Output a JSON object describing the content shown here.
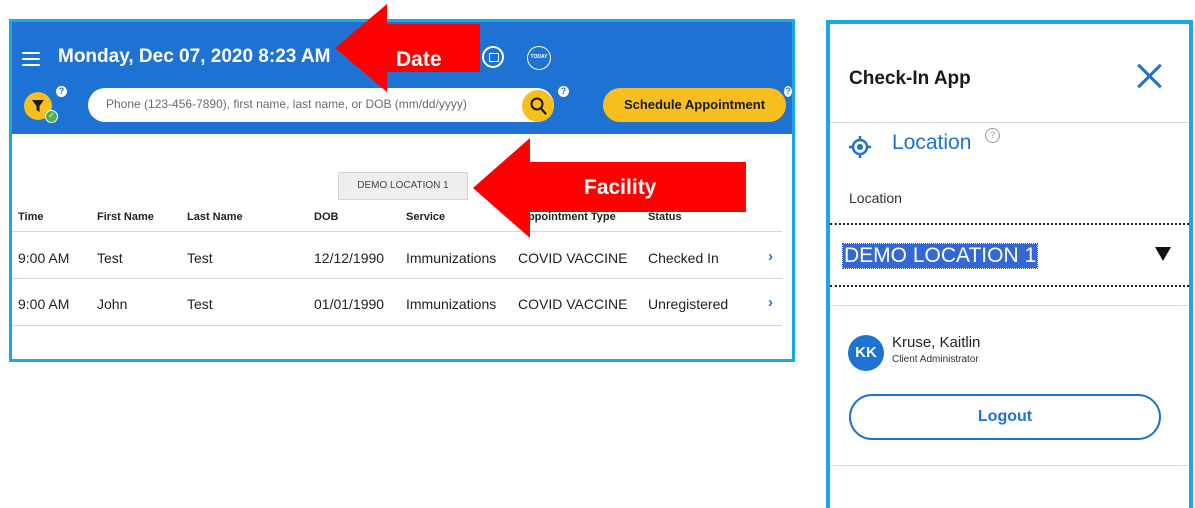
{
  "header": {
    "datetime": "Monday, Dec 07, 2020 8:23 AM",
    "today_label": "TODAY",
    "help_mark": "?"
  },
  "search": {
    "placeholder": "Phone (123-456-7890), first name, last name, or DOB (mm/dd/yyyy)"
  },
  "actions": {
    "schedule_label": "Schedule Appointment"
  },
  "facility_chip": "DEMO LOCATION 1",
  "table": {
    "headers": [
      "Time",
      "First Name",
      "Last Name",
      "DOB",
      "Service",
      "Appointment Type",
      "Status"
    ],
    "rows": [
      {
        "time": "9:00 AM",
        "first": "Test",
        "last": "Test",
        "dob": "12/12/1990",
        "service": "Immunizations",
        "type": "COVID VACCINE",
        "status": "Checked In"
      },
      {
        "time": "9:00 AM",
        "first": "John",
        "last": "Test",
        "dob": "01/01/1990",
        "service": "Immunizations",
        "type": "COVID VACCINE",
        "status": "Unregistered"
      }
    ],
    "row_chevron": "›"
  },
  "annotations": {
    "date_label": "Date",
    "facility_label": "Facility",
    "arrow_color": "#ff0000"
  },
  "drawer": {
    "title": "Check-In App",
    "location_heading": "Location",
    "help_mark": "?",
    "location_field_label": "Location",
    "location_value": "DEMO LOCATION 1",
    "user": {
      "initials": "KK",
      "name": "Kruse, Kaitlin",
      "role": "Client Administrator"
    },
    "logout_label": "Logout"
  },
  "colors": {
    "brand_blue": "#1d72d3",
    "accent_yellow": "#f6bf1f",
    "frame_cyan": "#19a7e6"
  },
  "icons": [
    "menu-icon",
    "calendar-icon",
    "today-icon",
    "filter-icon",
    "check-icon",
    "help-icon",
    "search-icon",
    "chevron-right-icon",
    "close-icon",
    "location-target-icon",
    "dropdown-caret-icon"
  ]
}
